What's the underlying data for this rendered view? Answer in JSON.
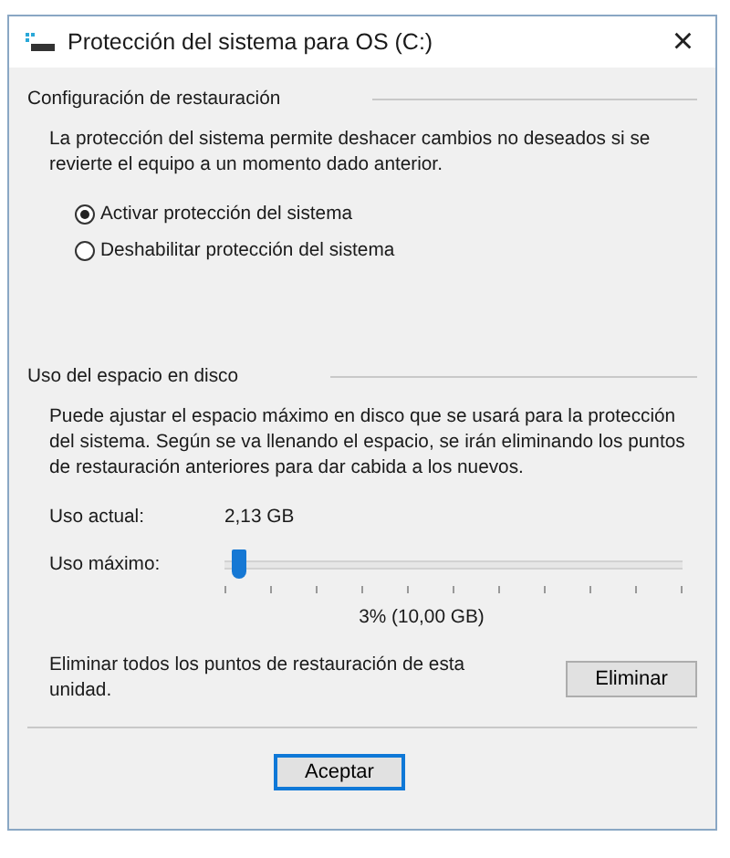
{
  "window": {
    "title": "Protección del sistema para OS (C:)",
    "close": "×"
  },
  "restore_settings": {
    "heading": "Configuración de restauración",
    "description": "La protección del sistema permite deshacer cambios no deseados si se revierte el equipo a un momento dado anterior.",
    "options": [
      {
        "label": "Activar protección del sistema",
        "selected": true
      },
      {
        "label": "Deshabilitar protección del sistema",
        "selected": false
      }
    ]
  },
  "disk_usage": {
    "heading": "Uso del espacio en disco",
    "description": "Puede ajustar el espacio máximo en disco que se usará para la protección del sistema. Según se va llenando el espacio, se irán eliminando los puntos de restauración anteriores para dar cabida a los nuevos.",
    "current_label": "Uso actual:",
    "current_value": "2,13 GB",
    "max_label": "Uso máximo:",
    "slider": {
      "level": 0.03
    },
    "max_reading": "3% (10,00 GB)",
    "delete_text": "Eliminar todos los puntos de restauración de esta unidad.",
    "delete_button": "Eliminar"
  },
  "buttons": [
    {
      "label": "Aceptar",
      "default": true
    }
  ]
}
